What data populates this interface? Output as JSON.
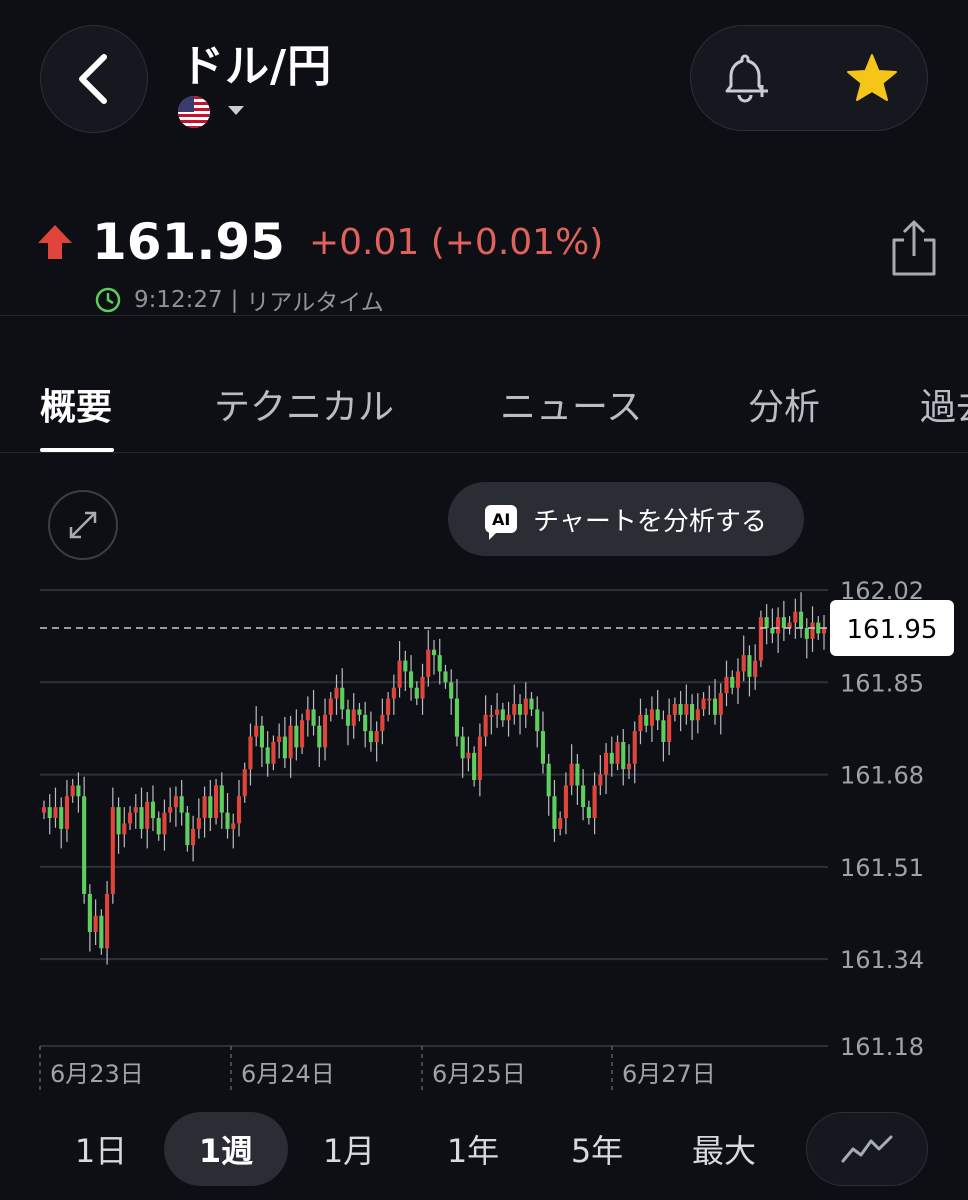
{
  "header": {
    "title": "ドル/円",
    "back_icon": "chevron-left-icon",
    "flag_icon": "us-flag-icon",
    "alert_icon": "bell-plus-icon",
    "favorite_icon": "star-icon"
  },
  "quote": {
    "price": "161.95",
    "change": "+0.01 (+0.01%)",
    "direction_icon": "arrow-up-icon",
    "time": "9:12:27",
    "separator": "|",
    "status": "リアルタイム",
    "share_icon": "share-icon"
  },
  "tabs": [
    "概要",
    "テクニカル",
    "ニュース",
    "分析",
    "過去"
  ],
  "chart_controls": {
    "expand_icon": "expand-icon",
    "ai_badge": "AI",
    "ai_label": "チャートを分析する"
  },
  "ranges": [
    "1日",
    "1週",
    "1月",
    "1年",
    "5年",
    "最大"
  ],
  "active_range": "1週",
  "chart_type_icon": "line-chart-icon",
  "colors": {
    "up": "#e0443a",
    "down": "#5ccf5c",
    "change_text": "#e0625b",
    "favorite": "#f5c518",
    "background": "#0d0f14"
  },
  "chart_data": {
    "type": "candlestick",
    "title": "",
    "xlabel": "",
    "ylabel": "",
    "ylim": [
      161.18,
      162.02
    ],
    "y_ticks": [
      "162.02",
      "161.85",
      "161.68",
      "161.51",
      "161.34",
      "161.18"
    ],
    "x_tick_labels": [
      "6月23日",
      "6月24日",
      "6月25日",
      "6月27日"
    ],
    "current_price": 161.95,
    "current_label": "161.95",
    "grid": true,
    "closes": [
      161.62,
      161.6,
      161.62,
      161.58,
      161.64,
      161.66,
      161.64,
      161.46,
      161.39,
      161.42,
      161.36,
      161.46,
      161.62,
      161.57,
      161.59,
      161.61,
      161.62,
      161.58,
      161.63,
      161.6,
      161.57,
      161.61,
      161.62,
      161.64,
      161.61,
      161.55,
      161.58,
      161.6,
      161.64,
      161.6,
      161.66,
      161.61,
      161.58,
      161.59,
      161.64,
      161.69,
      161.75,
      161.77,
      161.73,
      161.7,
      161.74,
      161.75,
      161.71,
      161.77,
      161.73,
      161.78,
      161.8,
      161.77,
      161.73,
      161.79,
      161.82,
      161.84,
      161.8,
      161.77,
      161.8,
      161.79,
      161.76,
      161.74,
      161.76,
      161.79,
      161.82,
      161.84,
      161.89,
      161.87,
      161.84,
      161.82,
      161.86,
      161.91,
      161.9,
      161.87,
      161.85,
      161.82,
      161.75,
      161.71,
      161.72,
      161.67,
      161.75,
      161.79,
      161.79,
      161.8,
      161.78,
      161.79,
      161.81,
      161.79,
      161.82,
      161.8,
      161.76,
      161.7,
      161.64,
      161.58,
      161.6,
      161.66,
      161.7,
      161.66,
      161.62,
      161.6,
      161.66,
      161.68,
      161.72,
      161.7,
      161.74,
      161.69,
      161.7,
      161.76,
      161.79,
      161.77,
      161.8,
      161.78,
      161.74,
      161.79,
      161.81,
      161.79,
      161.81,
      161.78,
      161.8,
      161.82,
      161.82,
      161.79,
      161.83,
      161.86,
      161.84,
      161.87,
      161.9,
      161.86,
      161.89,
      161.97,
      161.95,
      161.94,
      161.97,
      161.95,
      161.96,
      161.98,
      161.95,
      161.93,
      161.96,
      161.94,
      161.95
    ]
  }
}
